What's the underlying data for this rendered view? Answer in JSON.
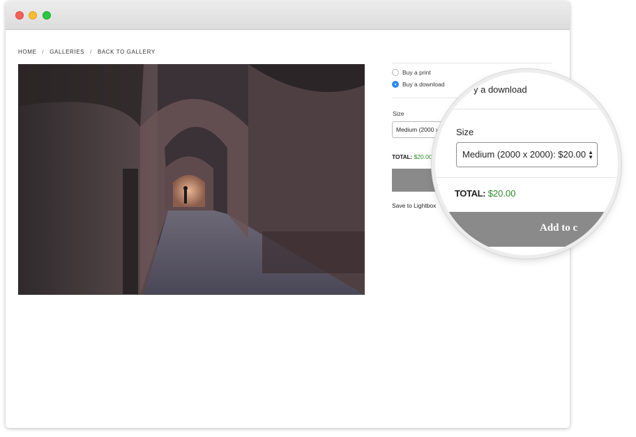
{
  "window": {
    "traffic_lights": {
      "close_color": "#fc5f57",
      "minimize_color": "#fdbc2e",
      "zoom_color": "#28c840"
    }
  },
  "breadcrumb": {
    "items": [
      "HOME",
      "GALLERIES",
      "BACK TO GALLERY"
    ],
    "separator": "/"
  },
  "photo": {
    "description_icon": "photo-arched-corridor"
  },
  "purchase": {
    "options": [
      {
        "label": "Buy a print",
        "selected": false
      },
      {
        "label": "Buy a download",
        "selected": true
      }
    ],
    "size_label": "Size",
    "size_value_truncated": "Medium (2000 x 20",
    "total_label": "TOTAL:",
    "total_value": "$20.00",
    "save_link": "Save to Lightbox",
    "accent_color": "#2f8af6",
    "price_color": "#2a8a2a",
    "button_color": "#8a8a8a"
  },
  "magnifier": {
    "download_label": "y a download",
    "size_label": "Size",
    "size_value": "Medium (2000 x 2000): $20.00",
    "total_label": "TOTAL:",
    "total_value": "$20.00",
    "add_button_label": "Add to c"
  }
}
